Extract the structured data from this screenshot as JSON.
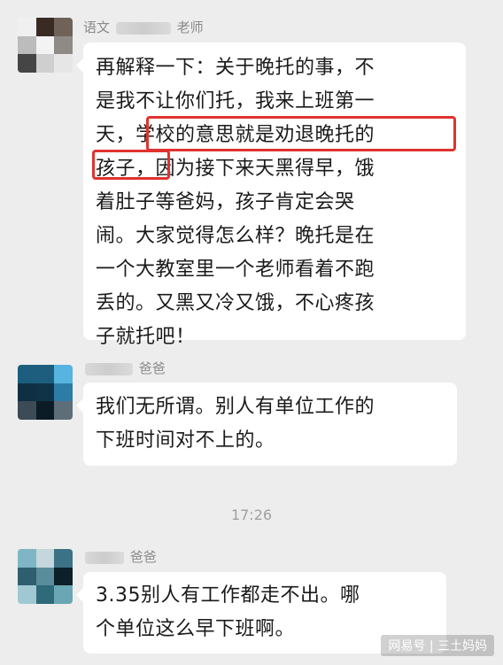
{
  "messages": [
    {
      "sender_prefix": "语文",
      "sender_suffix": "老师",
      "lines": [
        "再解释一下：关于晚托的事，不",
        "是我不让你们托，我来上班第一",
        "天，学校的意思就是劝退晚托的",
        "孩子，因为接下来天黑得早，饿",
        "着肚子等爸妈，孩子肯定会哭",
        "闹。大家觉得怎么样？晚托是在",
        "一个大教室里一个老师看着不跑",
        "丢的。又黑又冷又饿，不心疼孩",
        "子就托吧！"
      ],
      "avatar_colors": [
        "#f0f0f0",
        "#3a2a24",
        "#6f6259",
        "#bcbcbc",
        "#f3f3f3",
        "#8e8a86",
        "#454545",
        "#cfcfcf",
        "#e6e6e6"
      ]
    },
    {
      "sender_suffix": "爸爸",
      "lines": [
        "我们无所谓。别人有单位工作的",
        "下班时间对不上的。"
      ],
      "avatar_colors": [
        "#1d5e7e",
        "#1d5e7e",
        "#57b4e0",
        "#0f2f42",
        "#103447",
        "#2d7ca8",
        "#3c4b55",
        "#0c1c27",
        "#5e6e78"
      ]
    },
    {
      "sender_suffix": "爸爸",
      "lines": [
        "3.35别人有工作都走不出。哪",
        "个单位这么早下班啊。"
      ],
      "avatar_colors": [
        "#7fb6c6",
        "#c4d7dd",
        "#3c7285",
        "#2f5f6f",
        "#5a8d9b",
        "#0d1f27",
        "#9fc8d2",
        "#2e6a78",
        "#6aa6b4"
      ]
    }
  ],
  "timestamp": "17:26",
  "watermark": "网易号 | 三土妈妈",
  "colors": {
    "highlight": "#e0322e",
    "background": "#ededed",
    "bubble": "#ffffff"
  }
}
